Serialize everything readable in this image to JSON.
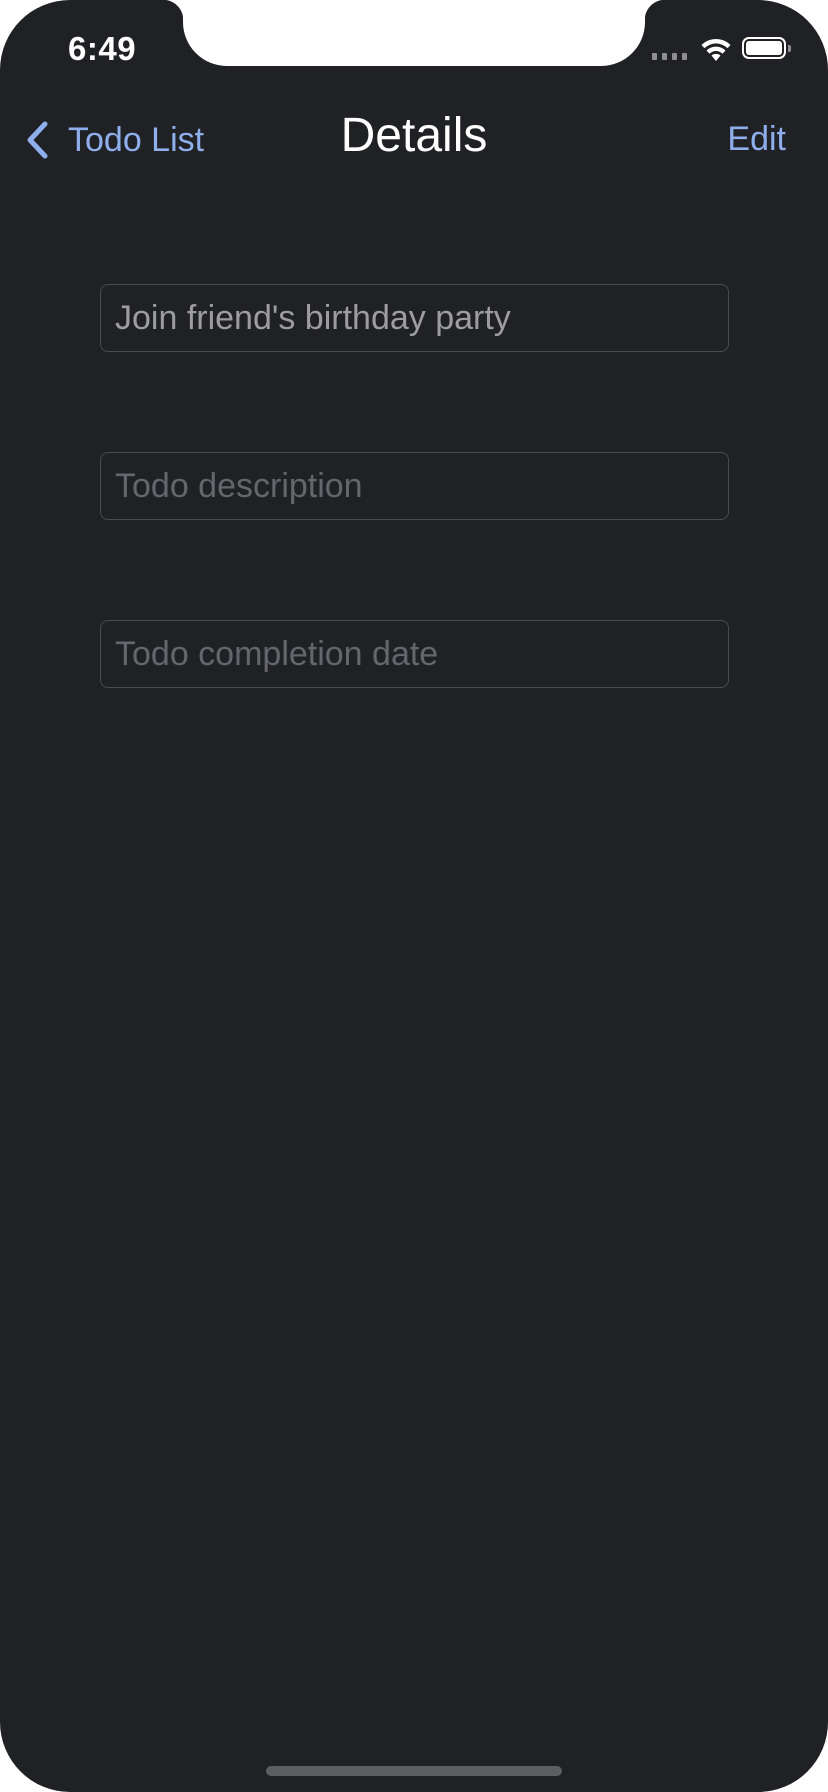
{
  "status_bar": {
    "time": "6:49",
    "wifi_icon": "wifi-icon",
    "battery_icon": "battery-icon",
    "signal_icon": "cellular-signal-icon"
  },
  "nav": {
    "back_label": "Todo List",
    "title": "Details",
    "edit_label": "Edit",
    "back_icon": "chevron-left-icon"
  },
  "form": {
    "title_value": "Join friend's birthday party",
    "description_value": "",
    "description_placeholder": "Todo description",
    "date_value": "",
    "date_placeholder": "Todo completion date"
  },
  "colors": {
    "background": "#202125",
    "accent": "#8eaeec",
    "text_primary": "#ffffff",
    "field_text": "#9c9ca1",
    "field_placeholder": "#65666b",
    "field_border": "#4a4b50"
  }
}
